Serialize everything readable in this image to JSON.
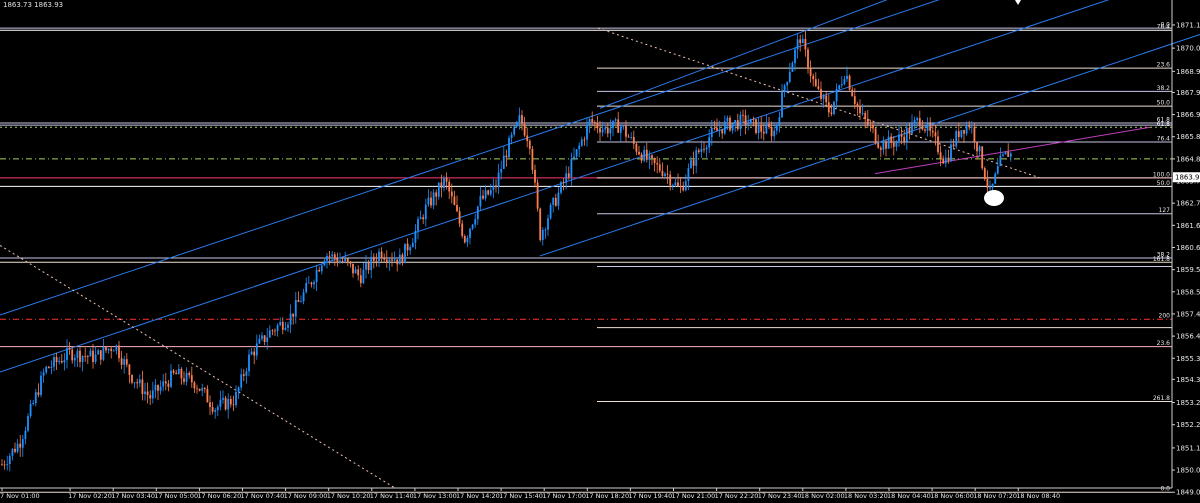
{
  "header": {
    "quote": "1863.73 1863.93"
  },
  "chart_data": {
    "type": "candlestick",
    "title": "",
    "symbol_quote": "1863.73 1863.93",
    "current_price": 1863.93,
    "ylim": [
      1849.2,
      1872.0
    ],
    "y_ticks": [
      1871.15,
      1870.05,
      1868.95,
      1867.95,
      1866.9,
      1865.85,
      1864.8,
      1863.75,
      1862.7,
      1861.65,
      1860.6,
      1859.55,
      1858.5,
      1857.45,
      1856.4,
      1855.35,
      1854.35,
      1853.25,
      1852.2,
      1851.1,
      1850.05,
      1849.0
    ],
    "y_tick_labels": [
      "1871.15",
      "1870.05",
      "1868.95",
      "1867.95",
      "1866.90",
      "1865.85",
      "1864.80",
      "1863.75",
      "1862.70",
      "1861.65",
      "1860.60",
      "1859.55",
      "1858.50",
      "1857.45",
      "1856.40",
      "1855.35",
      "1854.35",
      "1853.25",
      "1852.20",
      "1851.10",
      "1850.05",
      "1849.00"
    ],
    "x_labels": [
      "7 Nov 01:00",
      "17 Nov 02:20",
      "17 Nov 03:40",
      "17 Nov 05:00",
      "17 Nov 06:20",
      "17 Nov 07:40",
      "17 Nov 09:00",
      "17 Nov 10:20",
      "17 Nov 11:40",
      "17 Nov 13:00",
      "17 Nov 14:20",
      "17 Nov 15:40",
      "17 Nov 17:00",
      "17 Nov 18:20",
      "17 Nov 19:40",
      "17 Nov 21:00",
      "17 Nov 22:20",
      "17 Nov 23:40",
      "18 Nov 02:00",
      "18 Nov 03:20",
      "18 Nov 04:40",
      "18 Nov 06:00",
      "18 Nov 07:20",
      "18 Nov 08:40"
    ],
    "price_path": [
      [
        0,
        1850.2
      ],
      [
        20,
        1851.4
      ],
      [
        45,
        1854.8
      ],
      [
        70,
        1855.6
      ],
      [
        95,
        1855.4
      ],
      [
        115,
        1856.0
      ],
      [
        130,
        1854.6
      ],
      [
        150,
        1853.5
      ],
      [
        175,
        1854.6
      ],
      [
        195,
        1854.2
      ],
      [
        215,
        1853.0
      ],
      [
        235,
        1853.4
      ],
      [
        250,
        1855.5
      ],
      [
        270,
        1856.6
      ],
      [
        290,
        1857.3
      ],
      [
        310,
        1858.9
      ],
      [
        325,
        1860.3
      ],
      [
        345,
        1859.9
      ],
      [
        360,
        1859.2
      ],
      [
        380,
        1860.4
      ],
      [
        400,
        1860.0
      ],
      [
        415,
        1861.3
      ],
      [
        425,
        1862.4
      ],
      [
        445,
        1863.8
      ],
      [
        465,
        1861.0
      ],
      [
        480,
        1862.8
      ],
      [
        495,
        1863.4
      ],
      [
        505,
        1865.0
      ],
      [
        520,
        1866.7
      ],
      [
        530,
        1865.6
      ],
      [
        540,
        1861.2
      ],
      [
        550,
        1862.3
      ],
      [
        565,
        1863.8
      ],
      [
        575,
        1864.9
      ],
      [
        590,
        1866.6
      ],
      [
        605,
        1866.2
      ],
      [
        620,
        1866.4
      ],
      [
        635,
        1865.4
      ],
      [
        650,
        1864.6
      ],
      [
        665,
        1864.2
      ],
      [
        680,
        1863.3
      ],
      [
        695,
        1864.9
      ],
      [
        710,
        1865.9
      ],
      [
        725,
        1866.4
      ],
      [
        745,
        1866.6
      ],
      [
        760,
        1866.2
      ],
      [
        775,
        1866.1
      ],
      [
        785,
        1868.4
      ],
      [
        800,
        1870.6
      ],
      [
        815,
        1868.2
      ],
      [
        830,
        1867.0
      ],
      [
        845,
        1869.0
      ],
      [
        860,
        1866.9
      ],
      [
        870,
        1866.3
      ],
      [
        880,
        1865.5
      ],
      [
        895,
        1865.6
      ],
      [
        910,
        1866.2
      ],
      [
        920,
        1866.7
      ],
      [
        935,
        1865.6
      ],
      [
        945,
        1864.7
      ],
      [
        960,
        1866.2
      ],
      [
        970,
        1866.5
      ],
      [
        980,
        1865.0
      ],
      [
        990,
        1863.1
      ],
      [
        1000,
        1864.6
      ],
      [
        1010,
        1865.2
      ],
      [
        1015,
        1864.0
      ]
    ],
    "horizontal_levels": [
      {
        "price": 1871.0,
        "color": "#c9c6e6",
        "from": "full",
        "label": "0.0"
      },
      {
        "price": 1870.9,
        "color": "#ffffff",
        "from": "full",
        "label": "76.4"
      },
      {
        "price": 1869.1,
        "color": "#f0e0d0",
        "from": "mid",
        "label": "23.6"
      },
      {
        "price": 1868.0,
        "color": "#c9c6e6",
        "from": "mid",
        "label": "38.2"
      },
      {
        "price": 1867.3,
        "color": "#f0e0d0",
        "from": "mid",
        "label": "50.0"
      },
      {
        "price": 1866.5,
        "color": "#c9c6e6",
        "from": "full",
        "label": "61.8"
      },
      {
        "price": 1866.4,
        "color": "#c9c6e6",
        "from": "full",
        "label": ""
      },
      {
        "price": 1866.3,
        "color": "#a8d060",
        "from": "full",
        "dash": "2,3",
        "label": "61.8"
      },
      {
        "price": 1865.6,
        "color": "#c9c6e6",
        "from": "mid",
        "label": "76.4"
      },
      {
        "price": 1864.8,
        "color": "#a8d060",
        "from": "full",
        "dash": "6,3,1,3",
        "label": ""
      },
      {
        "price": 1863.9,
        "color": "#ff3a6e",
        "from": "full",
        "label": "100.0"
      },
      {
        "price": 1863.9,
        "color": "#f0e0d0",
        "from": "mid",
        "label": ""
      },
      {
        "price": 1863.5,
        "color": "#ffffff",
        "from": "full",
        "label": "50.0"
      },
      {
        "price": 1862.2,
        "color": "#c9c6e6",
        "from": "mid",
        "label": "127"
      },
      {
        "price": 1860.1,
        "color": "#c9c6e6",
        "from": "full",
        "label": "38.2"
      },
      {
        "price": 1859.9,
        "color": "#f0e0d0",
        "from": "full",
        "label": "161.8"
      },
      {
        "price": 1859.7,
        "color": "#c9c6e6",
        "from": "mid",
        "label": ""
      },
      {
        "price": 1857.2,
        "color": "#ff3030",
        "from": "full",
        "dash": "6,3,1,3",
        "label": "200"
      },
      {
        "price": 1856.8,
        "color": "#f0e0d0",
        "from": "mid",
        "label": ""
      },
      {
        "price": 1855.9,
        "color": "#ffb0c0",
        "from": "full",
        "label": "23.6"
      },
      {
        "price": 1853.3,
        "color": "#f0e0d0",
        "from": "mid",
        "label": "261.8"
      },
      {
        "price": 1849.0,
        "color": "#f0e0d0",
        "from": "full",
        "label": "0.0"
      }
    ],
    "channel_lines": [
      {
        "color": "#2a7cf0",
        "points": [
          [
            0,
            1854.7
          ],
          [
            1200,
            1873.8
          ]
        ]
      },
      {
        "color": "#2a7cf0",
        "points": [
          [
            0,
            1857.4
          ],
          [
            1200,
            1876.5
          ]
        ]
      },
      {
        "color": "#2a7cf0",
        "points": [
          [
            540,
            1860.2
          ],
          [
            1200,
            1870.7
          ]
        ]
      },
      {
        "color": "#2a7cf0",
        "points": [
          [
            600,
            1867.2
          ],
          [
            1035,
            1875.0
          ]
        ]
      }
    ],
    "trend_lines": [
      {
        "color": "#f0c0b0",
        "dash": "2,3",
        "points": [
          [
            0,
            1860.7
          ],
          [
            395,
            1849.2
          ]
        ]
      },
      {
        "color": "#f0c0b0",
        "dash": "2,3",
        "points": [
          [
            598,
            1871.0
          ],
          [
            1040,
            1863.9
          ]
        ]
      },
      {
        "color": "#c040c0",
        "dash": "",
        "points": [
          [
            875,
            1864.1
          ],
          [
            1150,
            1866.3
          ]
        ]
      }
    ],
    "current_price_label": "1863.93",
    "marker_label": "",
    "grid": false,
    "legend": "none"
  }
}
